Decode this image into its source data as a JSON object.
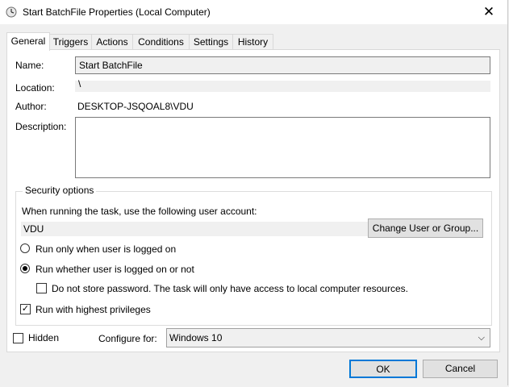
{
  "window": {
    "title": "Start BatchFile Properties (Local Computer)",
    "close_glyph": "✕",
    "clock_icon": "clock-icon"
  },
  "tabs": [
    {
      "label": "General",
      "active": true
    },
    {
      "label": "Triggers"
    },
    {
      "label": "Actions"
    },
    {
      "label": "Conditions"
    },
    {
      "label": "Settings"
    },
    {
      "label": "History"
    }
  ],
  "general": {
    "name_label": "Name:",
    "name_value": "Start BatchFile",
    "location_label": "Location:",
    "location_value": "\\",
    "author_label": "Author:",
    "author_value": "DESKTOP-JSQOAL8\\VDU",
    "description_label": "Description:",
    "description_value": ""
  },
  "security": {
    "group_title": "Security options",
    "prompt": "When running the task, use the following user account:",
    "user_account": "VDU",
    "change_button": "Change User or Group...",
    "radio_logged_on": "Run only when user is logged on",
    "radio_whether": "Run whether user is logged on or not",
    "radio_selected": "whether",
    "no_store_password": "Do not store password.  The task will only have access to local computer resources.",
    "no_store_password_checked": false,
    "highest_privileges": "Run with highest privileges",
    "highest_privileges_checked": true
  },
  "footer": {
    "hidden_label": "Hidden",
    "hidden_checked": false,
    "configure_label": "Configure for:",
    "configure_value": "Windows 10",
    "ok_button": "OK",
    "cancel_button": "Cancel"
  }
}
